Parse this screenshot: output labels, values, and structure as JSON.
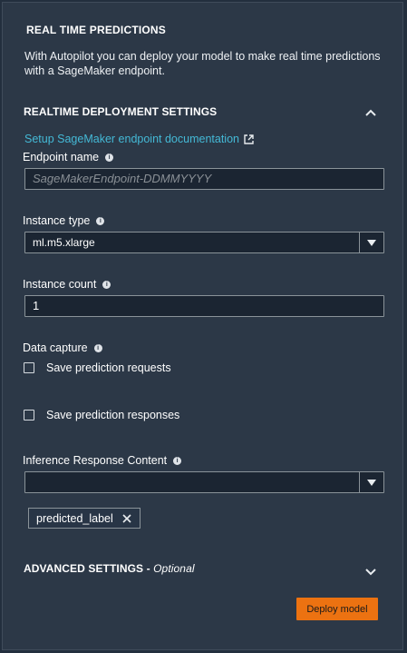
{
  "panel": {
    "title": "REAL TIME PREDICTIONS",
    "description": "With Autopilot you can deploy your model to make real time predictions with a SageMaker endpoint."
  },
  "deployment": {
    "section_title": "REALTIME DEPLOYMENT SETTINGS",
    "doc_link": "Setup SageMaker endpoint documentation",
    "endpoint": {
      "label": "Endpoint name",
      "placeholder": "SageMakerEndpoint-DDMMYYYY"
    },
    "instance_type": {
      "label": "Instance type",
      "value": "ml.m5.xlarge"
    },
    "instance_count": {
      "label": "Instance count",
      "value": "1"
    },
    "data_capture": {
      "label": "Data capture",
      "options": [
        {
          "label": "Save prediction requests",
          "checked": false
        },
        {
          "label": "Save prediction responses",
          "checked": false
        }
      ]
    },
    "inference_content": {
      "label": "Inference Response Content",
      "value": "",
      "tokens": [
        "predicted_label"
      ]
    }
  },
  "advanced": {
    "title": "ADVANCED SETTINGS",
    "separator": " - ",
    "optional": "Optional"
  },
  "actions": {
    "deploy_label": "Deploy model"
  },
  "colors": {
    "accent_link": "#44b9d6",
    "button_orange": "#ec7211",
    "panel_bg": "#2c3847"
  }
}
